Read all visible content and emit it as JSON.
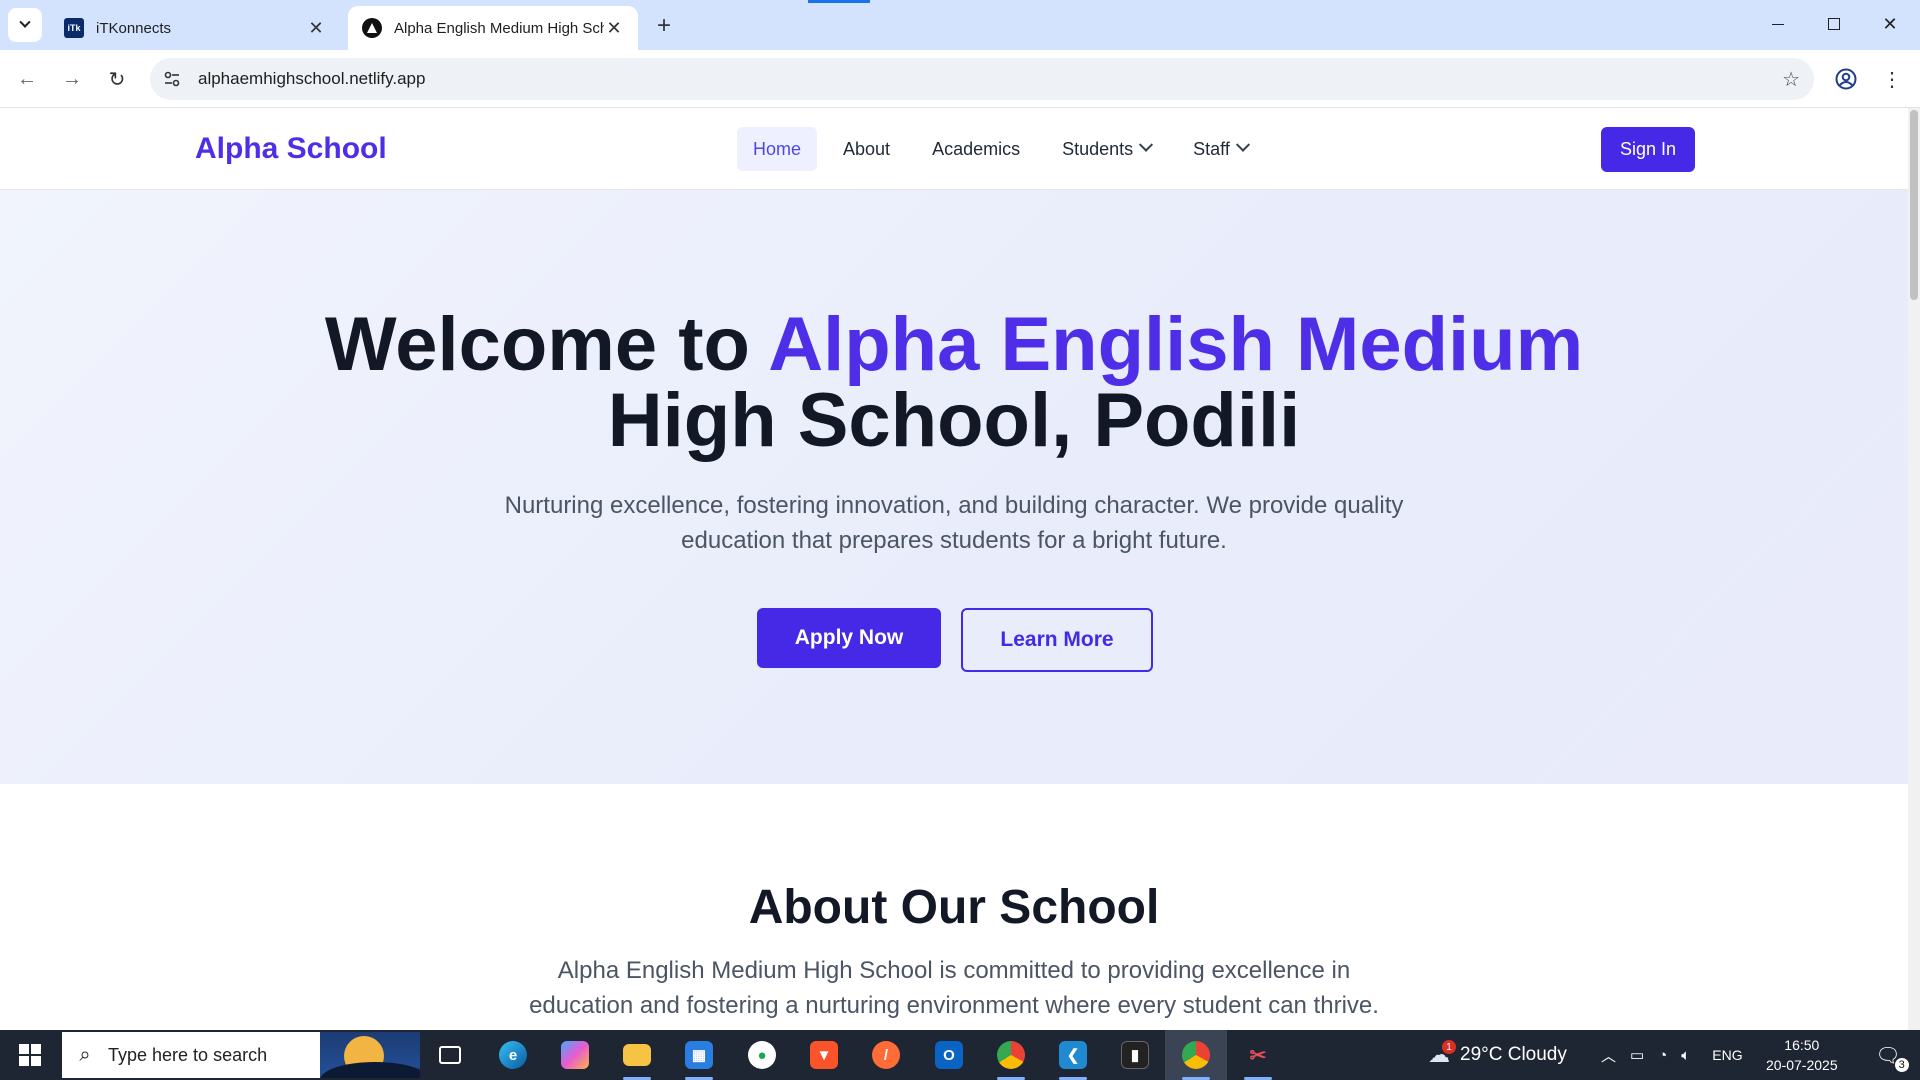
{
  "browser": {
    "tabs": [
      {
        "title": "iTKonnects",
        "favicon": "itk-favicon",
        "active": false
      },
      {
        "title": "Alpha English Medium High School",
        "favicon": "netlify-favicon",
        "active": true
      }
    ],
    "new_tab_symbol": "+",
    "url": "alphaemhighschool.netlify.app"
  },
  "site": {
    "brand": "Alpha School",
    "nav": {
      "home": "Home",
      "about": "About",
      "academics": "Academics",
      "students": "Students",
      "staff": "Staff"
    },
    "sign_in": "Sign In",
    "hero": {
      "title_prefix": "Welcome to ",
      "title_accent": "Alpha English Medium",
      "title_suffix": "High School, Podili",
      "subtitle": "Nurturing excellence, fostering innovation, and building character. We provide quality education that prepares students for a bright future.",
      "apply_button": "Apply Now",
      "learn_button": "Learn More"
    },
    "about": {
      "title": "About Our School",
      "text": "Alpha English Medium High School is committed to providing excellence in education and fostering a nurturing environment where every student can thrive."
    },
    "colors": {
      "accent": "#4f2ee8",
      "button": "#4529e6",
      "heading": "#121826"
    }
  },
  "taskbar": {
    "search_placeholder": "Type here to search",
    "weather": "29°C Cloudy",
    "weather_badge": "1",
    "language": "ENG",
    "time": "16:50",
    "date": "20-07-2025",
    "notification_count": "3",
    "pinned_apps": [
      "task-view-icon",
      "edge-icon",
      "copilot-icon",
      "file-explorer-icon",
      "calendar-icon",
      "mongodb-compass-icon",
      "brave-icon",
      "postman-icon",
      "outlook-icon",
      "chrome-dev-icon",
      "vscode-icon",
      "terminal-icon",
      "chrome-icon",
      "snipping-tool-icon"
    ]
  }
}
